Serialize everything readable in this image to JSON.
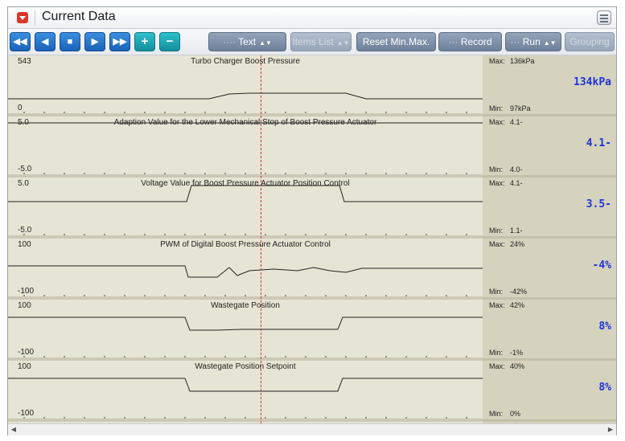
{
  "window": {
    "title": "Current Data",
    "menu_icon": "hamburger-icon"
  },
  "toolbar": {
    "nav_buttons": [
      {
        "name": "rewind-button",
        "glyph": "◀◀"
      },
      {
        "name": "step-back-button",
        "glyph": "◀"
      },
      {
        "name": "stop-button",
        "glyph": "■"
      },
      {
        "name": "play-button",
        "glyph": "▶"
      },
      {
        "name": "fast-forward-button",
        "glyph": "▶▶"
      },
      {
        "name": "zoom-in-button",
        "glyph": "+"
      },
      {
        "name": "zoom-out-button",
        "glyph": "−"
      }
    ],
    "text_label": "Text",
    "items_list_label": "Items List",
    "reset_label": "Reset Min.Max.",
    "record_label": "Record",
    "run_label": "Run",
    "grouping_label": "Grouping"
  },
  "panels": [
    {
      "title": "Turbo Charger Boost Pressure",
      "ymax": "543",
      "ymin": "0",
      "max": "136kPa",
      "min": "97kPa",
      "value": "134kPa",
      "max_label": "Max:",
      "min_label": "Min:"
    },
    {
      "title": "Adaption Value for the Lower Mechanical Stop of Boost Pressure Actuator",
      "ymax": "5.0",
      "ymin": "-5.0",
      "max": "4.1-",
      "min": "4.0-",
      "value": "4.1-",
      "max_label": "Max:",
      "min_label": "Min:"
    },
    {
      "title": "Voltage Value for Boost Pressure Actuator Position Control",
      "ymax": "5.0",
      "ymin": "-5.0",
      "max": "4.1-",
      "min": "1.1-",
      "value": "3.5-",
      "max_label": "Max:",
      "min_label": "Min:"
    },
    {
      "title": "PWM of Digital Boost Pressure Actuator Control",
      "ymax": "100",
      "ymin": "-100",
      "max": "24%",
      "min": "-42%",
      "value": "-4%",
      "max_label": "Max:",
      "min_label": "Min:"
    },
    {
      "title": "Wastegate Position",
      "ymax": "100",
      "ymin": "-100",
      "max": "42%",
      "min": "-1%",
      "value": "8%",
      "max_label": "Max:",
      "min_label": "Min:"
    },
    {
      "title": "Wastegate Position Setpoint",
      "ymax": "100",
      "ymin": "-100",
      "max": "40%",
      "min": "0%",
      "value": "8%",
      "max_label": "Max:",
      "min_label": "Min:"
    }
  ],
  "colors": {
    "cursor": "#d9322a",
    "value": "#1f35d6",
    "plot_bg": "#e6e4d4",
    "side_bg": "#d5d2bd"
  }
}
